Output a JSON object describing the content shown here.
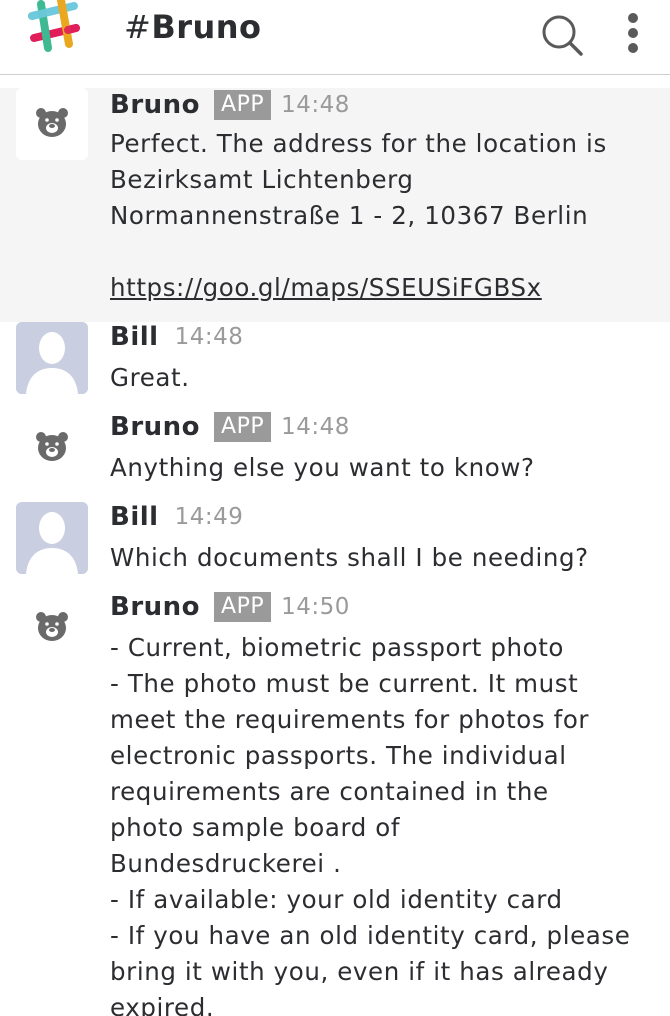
{
  "header": {
    "hash": "#",
    "channel_name": "Bruno",
    "search_icon": "search-icon",
    "more_icon": "vertical-ellipsis-icon"
  },
  "colors": {
    "highlight_bg": "#f5f5f5",
    "app_badge_bg": "#9a9a9a",
    "person_avatar_bg": "#c9cfe0",
    "timestamp": "#9a9a9a"
  },
  "messages": [
    {
      "sender": "Bruno",
      "badge": "APP",
      "time": "14:48",
      "avatar": "bear-icon",
      "lines": [
        "Perfect. The address for the location is",
        "Bezirksamt Lichtenberg",
        "Normannenstraße 1 - 2, 10367 Berlin",
        ""
      ],
      "link": "https://goo.gl/maps/SSEUSiFGBSx"
    },
    {
      "sender": "Bill",
      "time": "14:48",
      "avatar": "person-avatar",
      "lines": [
        "Great."
      ]
    },
    {
      "sender": "Bruno",
      "badge": "APP",
      "time": "14:48",
      "avatar": "bear-icon",
      "lines": [
        "Anything else you want to know?"
      ]
    },
    {
      "sender": "Bill",
      "time": "14:49",
      "avatar": "person-avatar",
      "lines": [
        "Which documents shall I be needing?"
      ]
    },
    {
      "sender": "Bruno",
      "badge": "APP",
      "time": "14:50",
      "avatar": "bear-icon",
      "lines": [
        "- Current, biometric passport photo",
        "- The photo must be current. It must",
        "meet the requirements for photos for",
        "electronic passports. The individual",
        "requirements are contained in the",
        "photo sample board of",
        "Bundesdruckerei .",
        "- If available: your old identity card",
        "- If you have an old identity card, please",
        "bring it with you, even if it has already",
        "expired."
      ]
    }
  ]
}
